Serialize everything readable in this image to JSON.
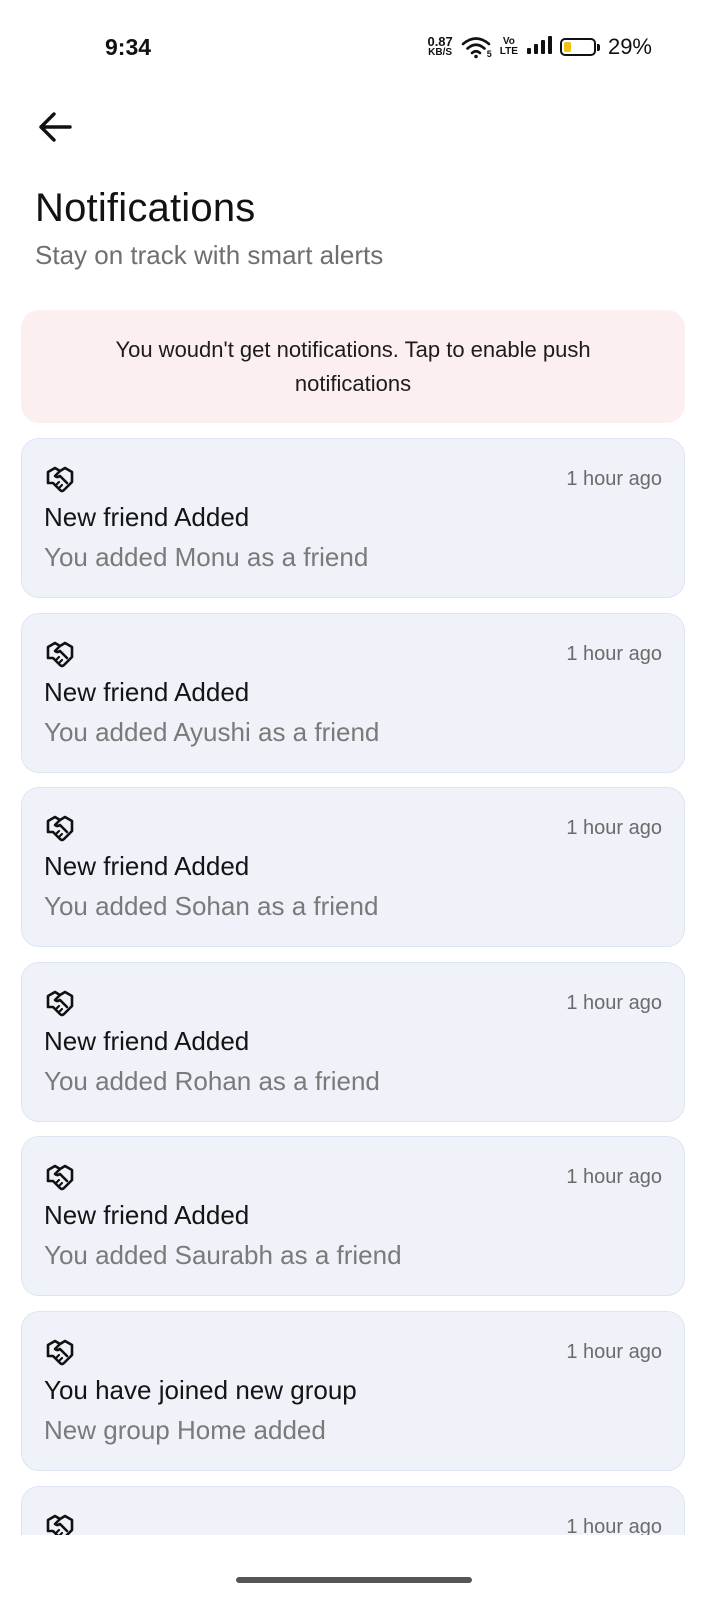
{
  "status_bar": {
    "time": "9:34",
    "net_speed_value": "0.87",
    "net_speed_unit": "KB/S",
    "wifi_badge": "5",
    "volte_top": "Vo",
    "volte_bottom": "LTE",
    "battery_percent": "29%",
    "battery_level": 0.29,
    "battery_color": "#f2c21b"
  },
  "header": {
    "back_icon": "arrow-left-icon",
    "title": "Notifications",
    "subtitle": "Stay on track with smart alerts"
  },
  "banner": {
    "text": "You woudn't get notifications. Tap to enable push notifications",
    "background": "#fcefef"
  },
  "notifications": [
    {
      "icon": "handshake-icon",
      "title": "New friend Added",
      "body": "You added Monu as a friend",
      "time": "1 hour ago"
    },
    {
      "icon": "handshake-icon",
      "title": "New friend Added",
      "body": "You added Ayushi as a friend",
      "time": "1 hour ago"
    },
    {
      "icon": "handshake-icon",
      "title": "New friend Added",
      "body": "You added Sohan as a friend",
      "time": "1 hour ago"
    },
    {
      "icon": "handshake-icon",
      "title": "New friend Added",
      "body": "You added Rohan as a friend",
      "time": "1 hour ago"
    },
    {
      "icon": "handshake-icon",
      "title": "New friend Added",
      "body": "You added Saurabh as a friend",
      "time": "1 hour ago"
    },
    {
      "icon": "handshake-icon",
      "title": "You have joined new group",
      "body": "New group Home added",
      "time": "1 hour ago"
    },
    {
      "icon": "handshake-icon",
      "title": "",
      "body": "",
      "time": "1 hour ago"
    }
  ],
  "colors": {
    "card_background": "#eff2f8",
    "card_border": "#dde4f4",
    "muted_text": "#7a7a7a"
  }
}
